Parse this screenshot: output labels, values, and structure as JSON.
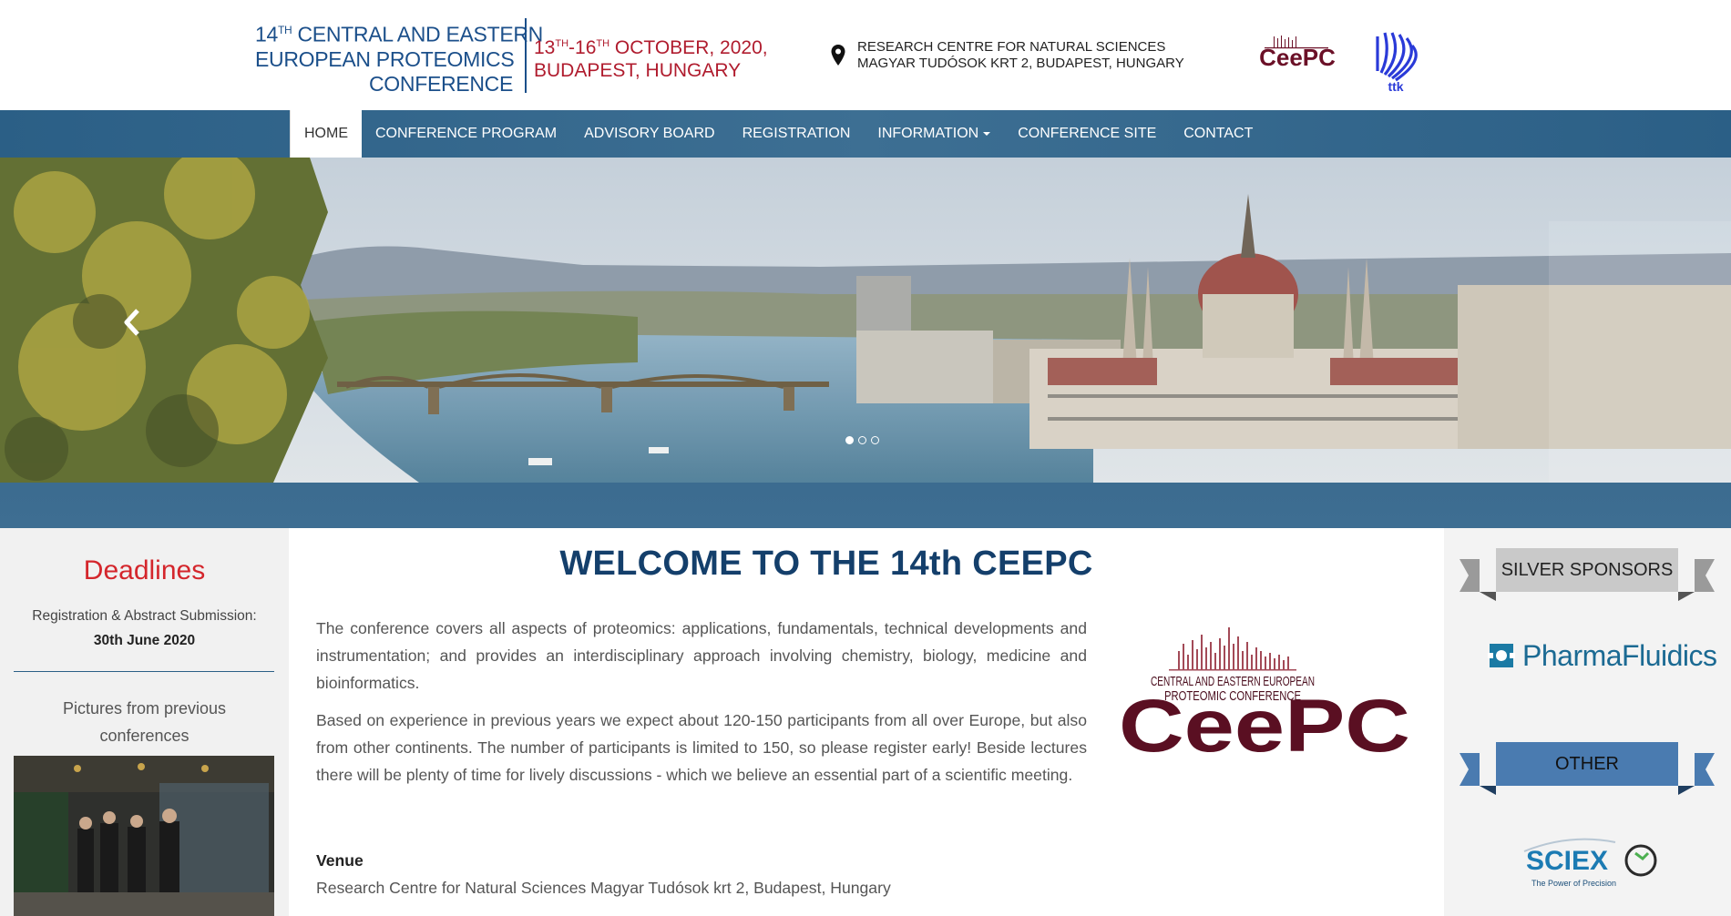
{
  "header": {
    "title_line1_num": "14",
    "title_line1_sup": "TH",
    "title_line1_rest": " CENTRAL AND EASTERN",
    "title_line2": "EUROPEAN PROTEOMICS",
    "title_line3": "CONFERENCE",
    "date_start": "13",
    "date_start_sup": "TH",
    "date_dash": "-16",
    "date_end_sup": "TH",
    "date_rest": " OCTOBER, 2020,",
    "date_city": "BUDAPEST, HUNGARY",
    "address_line1": "RESEARCH CENTRE FOR NATURAL SCIENCES",
    "address_line2": "MAGYAR TUDÓSOK KRT 2, BUDAPEST, HUNGARY",
    "ttk_logo_text": "ttk",
    "ceepc_logo_text": "CeePC"
  },
  "nav": {
    "items": [
      {
        "label": "HOME",
        "active": true
      },
      {
        "label": "CONFERENCE PROGRAM"
      },
      {
        "label": "ADVISORY BOARD"
      },
      {
        "label": "REGISTRATION"
      },
      {
        "label": "INFORMATION"
      },
      {
        "label": "CONFERENCE SITE"
      },
      {
        "label": "CONTACT"
      }
    ]
  },
  "hero": {
    "slide_count": 3,
    "active_slide": 1
  },
  "left": {
    "deadlines_title": "Deadlines",
    "deadline_text": "Registration & Abstract Submission:",
    "deadline_date": "30th June 2020",
    "pictures_title": "Pictures from previous conferences"
  },
  "main": {
    "welcome": "WELCOME TO THE 14th CEEPC",
    "paragraph1": "The conference covers all aspects of proteomics: applications, fundamentals, technical developments and instrumentation; and provides an interdisciplinary approach involving chemistry, biology, medicine and bioinformatics.",
    "paragraph2": "Based on experience in previous years we expect about 120-150 participants from all over Europe, but also from other continents. The number of participants is limited to 150, so please register early! Beside lectures there will be plenty of time for lively discussions - which we believe an essential part of a scientific meeting.",
    "venue_label": "Venue",
    "venue_text": "Research Centre for Natural Sciences Magyar Tudósok krt 2, Budapest, Hungary",
    "logo_line1": "CENTRAL AND EASTERN EUROPEAN",
    "logo_line2": "PROTEOMIC CONFERENCE",
    "logo_text": "CeePC"
  },
  "right": {
    "silver_title": "SILVER SPONSORS",
    "pharma_name": "PharmaFluidics",
    "other_title": "OTHER",
    "sciex_name": "SCIEX",
    "sciex_tagline": "The Power of Precision"
  },
  "colors": {
    "brand_blue": "#1b4f8a",
    "brand_red": "#b01c2e",
    "nav_bg": "#2b5f86",
    "ceepc_maroon": "#6b1027",
    "deadline_red": "#d4262c"
  }
}
